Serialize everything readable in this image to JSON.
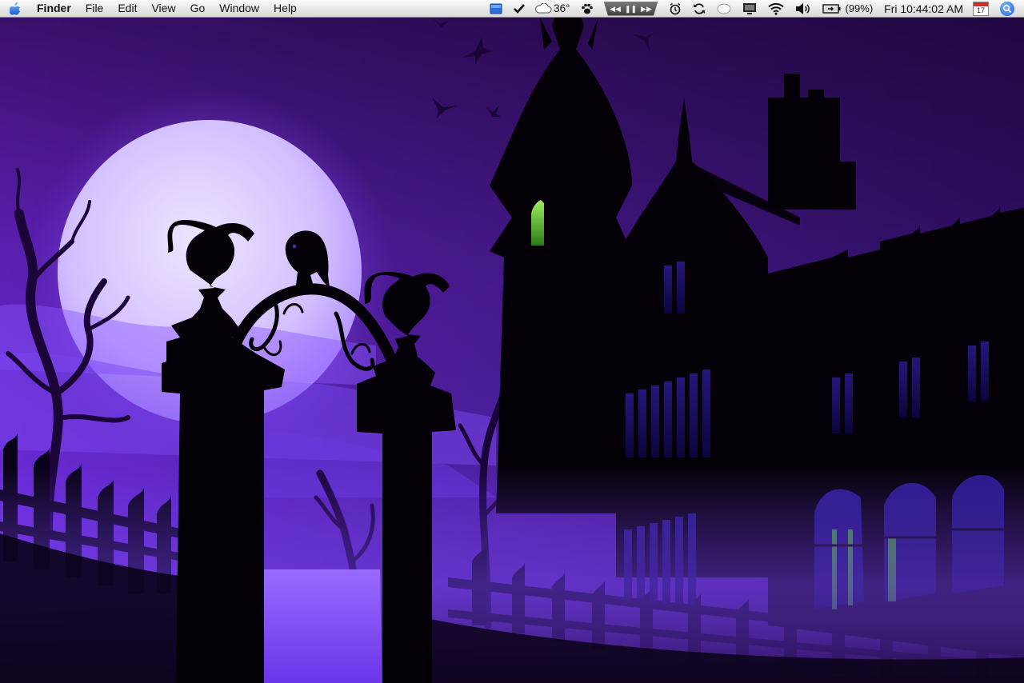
{
  "menubar": {
    "app_name": "Finder",
    "menus": [
      "File",
      "Edit",
      "View",
      "Go",
      "Window",
      "Help"
    ],
    "status": {
      "weather_temp": "36°",
      "battery_percent": "(99%)",
      "clock": "Fri 10:44:02 AM",
      "calendar_day": "17"
    }
  },
  "desktop": {
    "wallpaper_theme": "Halloween haunted mansion silhouette with full moon",
    "colors": {
      "sky_top": "#3a0f6b",
      "sky_mid": "#6a2bd6",
      "moon": "#d8c8ff",
      "silhouette": "#050008",
      "window_glow": "#7ee04a"
    }
  }
}
